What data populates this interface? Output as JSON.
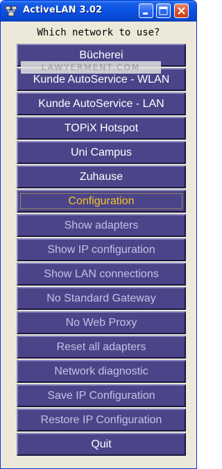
{
  "window": {
    "title": "ActiveLAN 3.02"
  },
  "titlebar_buttons": {
    "minimize_icon": "minimize-icon",
    "maximize_icon": "maximize-icon",
    "close_icon": "close-icon"
  },
  "prompt": "Which network to use?",
  "watermark": "LAWYERMENT.COM",
  "menu": {
    "items": [
      {
        "label": "Bücherei",
        "style": "normal"
      },
      {
        "label": "Kunde AutoService - WLAN",
        "style": "normal"
      },
      {
        "label": "Kunde AutoService - LAN",
        "style": "normal"
      },
      {
        "label": "TOPiX Hotspot",
        "style": "normal"
      },
      {
        "label": "Uni Campus",
        "style": "normal"
      },
      {
        "label": "Zuhause",
        "style": "normal"
      },
      {
        "label": "Configuration",
        "style": "active"
      },
      {
        "label": "Show adapters",
        "style": "light"
      },
      {
        "label": "Show IP configuration",
        "style": "light"
      },
      {
        "label": "Show LAN connections",
        "style": "light"
      },
      {
        "label": "No Standard Gateway",
        "style": "light"
      },
      {
        "label": "No Web Proxy",
        "style": "light"
      },
      {
        "label": "Reset all adapters",
        "style": "light"
      },
      {
        "label": "Network diagnostic",
        "style": "light"
      },
      {
        "label": "Save IP Configuration",
        "style": "light"
      },
      {
        "label": "Restore IP Configuration",
        "style": "light"
      },
      {
        "label": "Quit",
        "style": "normal"
      }
    ]
  },
  "colors": {
    "button_bg": "#4b4488",
    "active_text": "#f3c42a",
    "light_text": "#c4c2e6",
    "titlebar": "#0b52e3"
  }
}
